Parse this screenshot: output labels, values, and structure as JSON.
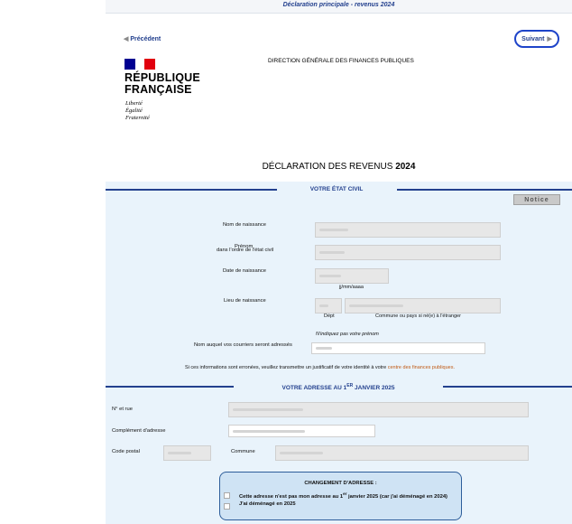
{
  "header": {
    "title": "Déclaration principale - revenus 2024"
  },
  "nav": {
    "previous_label": "Précédent",
    "next_label": "Suivant"
  },
  "logo": {
    "line1": "RÉPUBLIQUE",
    "line2": "FRANÇAISE",
    "motto1": "Liberté",
    "motto2": "Égalité",
    "motto3": "Fraternité",
    "colors": [
      "#000091",
      "#ffffff",
      "#e1000f"
    ]
  },
  "agency": "DIRECTION GÉNÉRALE DES FINANCES PUBLIQUES",
  "page_title": {
    "text": "DÉCLARATION DES REVENUS",
    "year": "2024"
  },
  "etat_civil": {
    "section_title": "VOTRE ÉTAT CIVIL",
    "notice_label": "Notice",
    "nom_naissance_label": "Nom de naissance",
    "prenom_label": "Prénom",
    "prenom_sub_label": "dans l'ordre de l'état civil",
    "date_naissance_label": "Date de naissance",
    "date_format_hint": "jj/mm/aaaa",
    "lieu_naissance_label": "Lieu de naissance",
    "dept_hint": "Dépt",
    "commune_hint": "Commune ou pays si né(e) à l'étranger",
    "courrier_hint": "N'indiquez pas votre prénom",
    "courrier_label": "Nom auquel vos courriers seront adressés",
    "erreur_text": "Si ces informations sont erronées, veuillez transmettre un justificatif de votre identité à votre",
    "erreur_link": "centre des finances publiques."
  },
  "adresse": {
    "section_title_prefix": "VOTRE ADRESSE AU 1",
    "section_title_sup": "ER",
    "section_title_suffix": "JANVIER 2025",
    "rue_label": "N° et rue",
    "complement_label": "Complément d'adresse",
    "code_postal_label": "Code postal",
    "commune_label": "Commune"
  },
  "changement": {
    "title": "CHANGEMENT D'ADRESSE :",
    "option1_prefix": "Cette adresse n'est pas mon adresse au 1",
    "option1_sup": "er",
    "option1_suffix": "janvier 2025 (car j'ai déménagé en 2024)",
    "option2": "J'ai déménagé en 2025"
  }
}
